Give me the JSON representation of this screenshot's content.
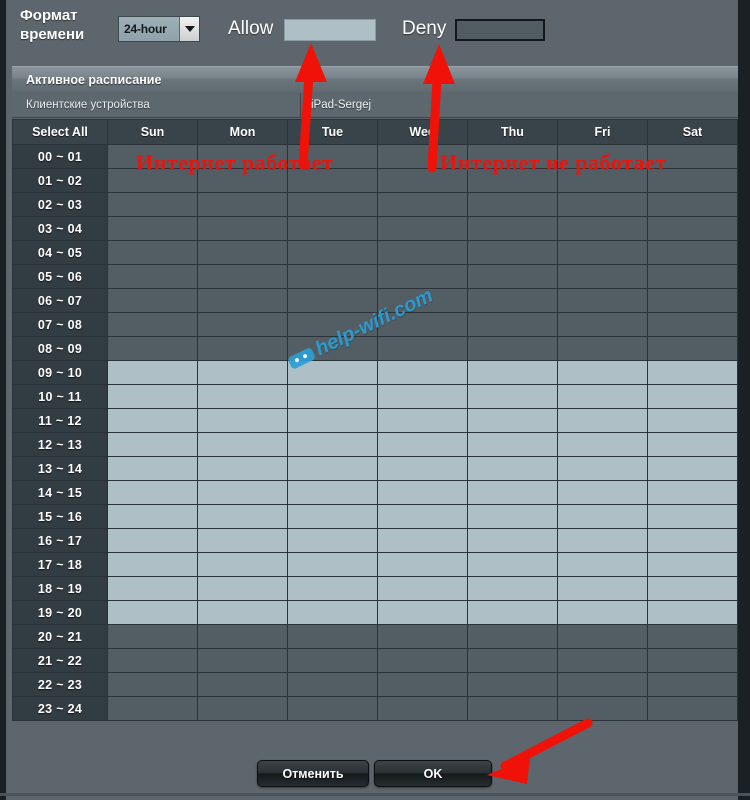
{
  "window": {
    "background_color": "#5c666c",
    "gutter_color": "#1b2024"
  },
  "toolbar": {
    "time_format_label": "Формат\nвремени",
    "time_format_label_line1": "Формат",
    "time_format_label_line2": "времени",
    "time_format_value": "24-hour",
    "time_format_options": [
      "24-hour"
    ],
    "allow_label": "Allow",
    "allow_color": "#aebfc6",
    "deny_label": "Deny",
    "deny_color": "#525c63"
  },
  "section": {
    "title": "Активное расписание"
  },
  "client": {
    "label": "Клиентские устройства",
    "value": "iPad-Sergej"
  },
  "schedule": {
    "select_all_label": "Select All",
    "days": [
      "Sun",
      "Mon",
      "Tue",
      "Wed",
      "Thu",
      "Fri",
      "Sat"
    ],
    "hours": [
      "00 ~ 01",
      "01 ~ 02",
      "02 ~ 03",
      "03 ~ 04",
      "04 ~ 05",
      "05 ~ 06",
      "06 ~ 07",
      "07 ~ 08",
      "08 ~ 09",
      "09 ~ 10",
      "10 ~ 11",
      "11 ~ 12",
      "12 ~ 13",
      "13 ~ 14",
      "14 ~ 15",
      "15 ~ 16",
      "16 ~ 17",
      "17 ~ 18",
      "18 ~ 19",
      "19 ~ 20",
      "20 ~ 21",
      "21 ~ 22",
      "22 ~ 23",
      "23 ~ 24"
    ],
    "selected": [
      [
        false,
        false,
        false,
        false,
        false,
        false,
        false
      ],
      [
        false,
        false,
        false,
        false,
        false,
        false,
        false
      ],
      [
        false,
        false,
        false,
        false,
        false,
        false,
        false
      ],
      [
        false,
        false,
        false,
        false,
        false,
        false,
        false
      ],
      [
        false,
        false,
        false,
        false,
        false,
        false,
        false
      ],
      [
        false,
        false,
        false,
        false,
        false,
        false,
        false
      ],
      [
        false,
        false,
        false,
        false,
        false,
        false,
        false
      ],
      [
        false,
        false,
        false,
        false,
        false,
        false,
        false
      ],
      [
        false,
        false,
        false,
        false,
        false,
        false,
        false
      ],
      [
        true,
        true,
        true,
        true,
        true,
        true,
        true
      ],
      [
        true,
        true,
        true,
        true,
        true,
        true,
        true
      ],
      [
        true,
        true,
        true,
        true,
        true,
        true,
        true
      ],
      [
        true,
        true,
        true,
        true,
        true,
        true,
        true
      ],
      [
        true,
        true,
        true,
        true,
        true,
        true,
        true
      ],
      [
        true,
        true,
        true,
        true,
        true,
        true,
        true
      ],
      [
        true,
        true,
        true,
        true,
        true,
        true,
        true
      ],
      [
        true,
        true,
        true,
        true,
        true,
        true,
        true
      ],
      [
        true,
        true,
        true,
        true,
        true,
        true,
        true
      ],
      [
        true,
        true,
        true,
        true,
        true,
        true,
        true
      ],
      [
        true,
        true,
        true,
        true,
        true,
        true,
        true
      ],
      [
        false,
        false,
        false,
        false,
        false,
        false,
        false
      ],
      [
        false,
        false,
        false,
        false,
        false,
        false,
        false
      ],
      [
        false,
        false,
        false,
        false,
        false,
        false,
        false
      ],
      [
        false,
        false,
        false,
        false,
        false,
        false,
        false
      ]
    ]
  },
  "footer": {
    "cancel_label": "Отменить",
    "ok_label": "OK"
  },
  "annotations": {
    "color": "#e8150f",
    "internet_works": "Интернет работает",
    "internet_not_works": "Интернет не работает"
  },
  "watermark": {
    "text": "help-wifi.com",
    "color": "#2c9fd6"
  }
}
